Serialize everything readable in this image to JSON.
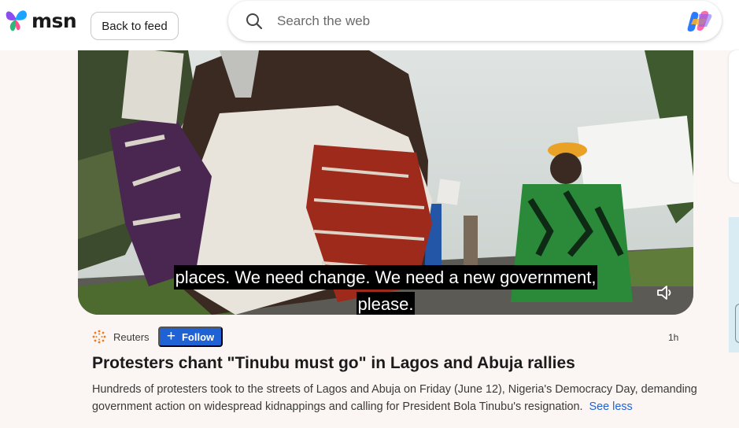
{
  "header": {
    "logo_text": "msn",
    "back_label": "Back to feed",
    "search_placeholder": "Search the web",
    "icons": [
      "search-icon",
      "copilot-icon"
    ]
  },
  "video": {
    "caption_line1": "places. We need change. We need a new government,",
    "caption_line2": "please.",
    "icon": "speaker-icon"
  },
  "article": {
    "publisher": "Reuters",
    "follow_label": "Follow",
    "time": "1h",
    "headline": "Protesters chant \"Tinubu must go\" in Lagos and Abuja rallies",
    "summary": "Hundreds of protesters took to the streets of Lagos and Abuja on Friday (June 12), Nigeria's Democracy Day, demanding government action on widespread kidnappings and calling for President Bola Tinubu's resignation.",
    "see_less": "See less"
  },
  "colors": {
    "accent": "#1f62d6",
    "page_bg": "#fbf6f3"
  }
}
